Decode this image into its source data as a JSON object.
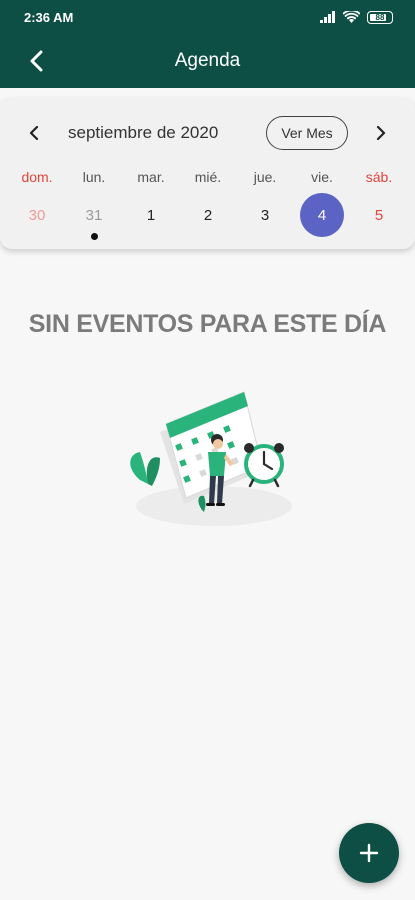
{
  "status_bar": {
    "time": "2:36 AM",
    "battery": "88"
  },
  "app_bar": {
    "title": "Agenda"
  },
  "calendar": {
    "month_label": "septiembre de 2020",
    "view_month_button": "Ver Mes",
    "weekdays": [
      "dom.",
      "lun.",
      "mar.",
      "mié.",
      "jue.",
      "vie.",
      "sáb."
    ],
    "dates": [
      "30",
      "31",
      "1",
      "2",
      "3",
      "4",
      "5"
    ],
    "selected_date": "4",
    "event_marker_date": "31"
  },
  "empty_state": {
    "title": "SIN EVENTOS PARA ESTE DÍA"
  },
  "colors": {
    "primary": "#0d4f45",
    "accent": "#5b64c4",
    "weekend": "#e0443c",
    "illustration_green": "#2bb37c"
  },
  "icons": {
    "back": "arrow-left-icon",
    "prev": "chevron-left-icon",
    "next": "chevron-right-icon",
    "fab": "plus-icon"
  }
}
